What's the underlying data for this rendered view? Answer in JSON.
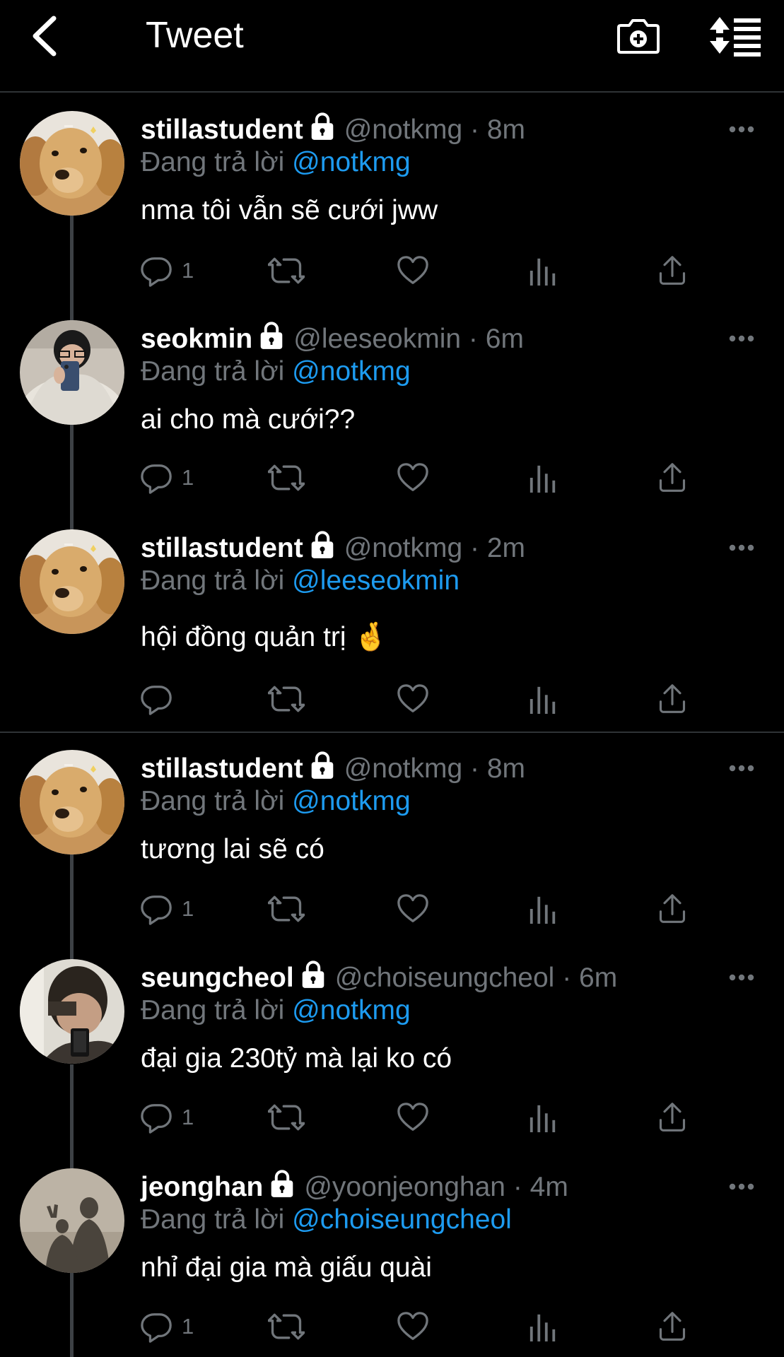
{
  "header": {
    "title": "Tweet",
    "back_icon": "chevron-left-icon",
    "camera_icon": "camera-plus-icon",
    "sort_icon": "sort-list-icon"
  },
  "colors": {
    "background": "#000000",
    "text": "#ffffff",
    "secondary": "#71767b",
    "link": "#1d9bf0",
    "divider": "#2f3336"
  },
  "reply_prefix": "Đang trả lời",
  "tweets": [
    {
      "name": "stillastudent",
      "handle": "@notkmg",
      "time": "8m",
      "reply_to": "@notkmg",
      "text": "nma tôi vẫn sẽ cưới jww",
      "reply_count": "1",
      "avatar": "golden-retriever"
    },
    {
      "name": "seokmin",
      "handle": "@leeseokmin",
      "time": "6m",
      "reply_to": "@notkmg",
      "text": "ai cho mà cưới??",
      "reply_count": "1",
      "avatar": "mirror-selfie"
    },
    {
      "name": "stillastudent",
      "handle": "@notkmg",
      "time": "2m",
      "reply_to": "@leeseokmin",
      "text": "hội đồng quản trị 🤞",
      "reply_count": "",
      "avatar": "golden-retriever"
    },
    {
      "name": "stillastudent",
      "handle": "@notkmg",
      "time": "8m",
      "reply_to": "@notkmg",
      "text": "tương lai sẽ có",
      "reply_count": "1",
      "avatar": "golden-retriever"
    },
    {
      "name": "seungcheol",
      "handle": "@choiseungcheol",
      "time": "6m",
      "reply_to": "@notkmg",
      "text": "đại gia 230tỷ mà lại ko có",
      "reply_count": "1",
      "avatar": "car-selfie"
    },
    {
      "name": "jeonghan",
      "handle": "@yoonjeonghan",
      "time": "4m",
      "reply_to": "@choiseungcheol",
      "text": "nhỉ đại gia mà giấu quài",
      "reply_count": "1",
      "avatar": "shadow-photo"
    }
  ]
}
